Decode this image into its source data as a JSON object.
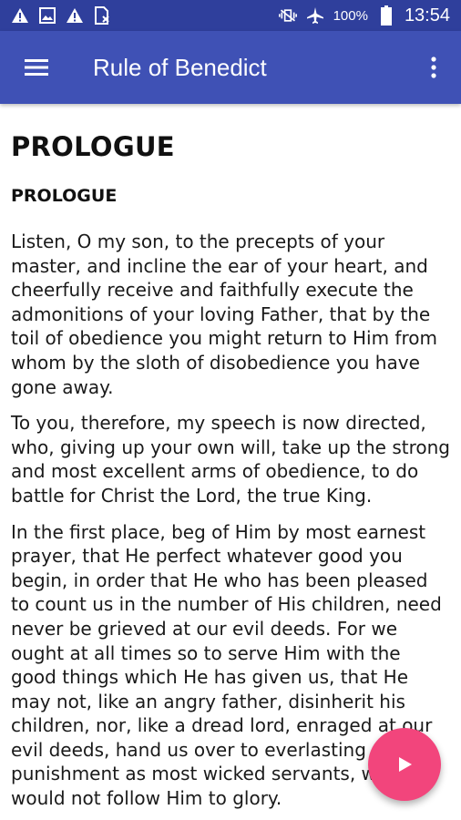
{
  "status_bar": {
    "battery": "100%",
    "time": "13:54",
    "icons": [
      "warning-icon",
      "image-icon",
      "warning-icon",
      "sim-card-icon",
      "vibrate-icon",
      "airplane-icon",
      "battery-icon"
    ]
  },
  "app_bar": {
    "title": "Rule of Benedict",
    "color": "#3f51b5"
  },
  "content": {
    "title": "PROLOGUE",
    "section_title": "PROLOGUE",
    "paragraphs": [
      "Listen, O my son, to the precepts of your master, and incline the ear of your heart, and cheerfully receive and faithfully execute the admonitions of your loving Father, that by the toil of obedience you might return to Him from whom by the sloth of disobedience you have gone away.",
      "To you, therefore, my speech is now directed, who, giving up your own will, take up the strong and most excellent arms of obedience, to do battle for Christ the Lord, the true King.",
      "In the first place, beg of Him by most earnest prayer, that He perfect whatever good you begin, in order that He who has been pleased to count us in the number of His children, need never be grieved at our evil deeds. For we ought at all times so to serve Him with the good things which He has given us, that He may not, like an angry father, disinherit his children, nor, like a dread lord, enraged at our evil deeds, hand us over to everlasting punishment as most wicked servants, who would not follow Him to glory."
    ]
  },
  "fab": {
    "icon": "play-icon",
    "color": "#f2457c"
  }
}
